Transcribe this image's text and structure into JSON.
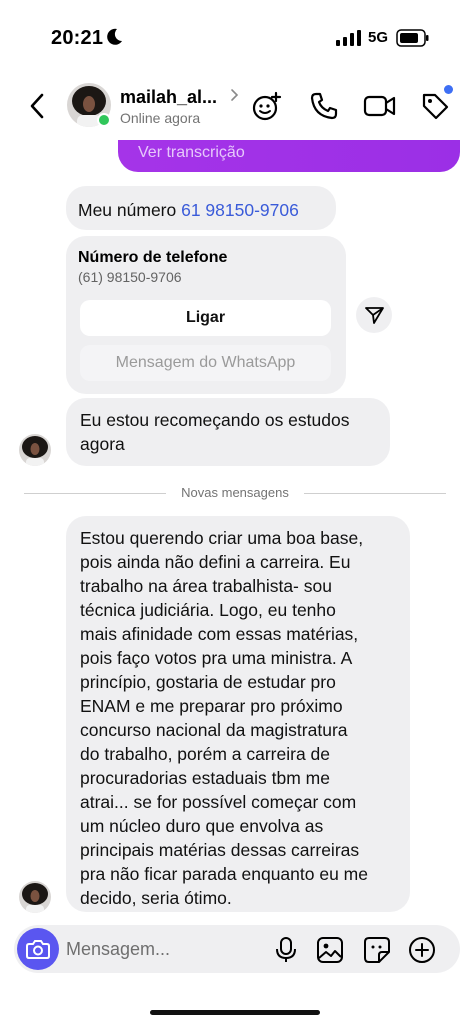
{
  "status_bar": {
    "time": "20:21",
    "network": "5G",
    "icons": [
      "moon-icon",
      "signal-icon",
      "battery-icon"
    ]
  },
  "header": {
    "contact_name": "mailah_al...",
    "contact_status": "Online agora",
    "icons": [
      "back-icon",
      "sticker-effects-icon",
      "phone-icon",
      "video-icon",
      "tag-icon"
    ],
    "online_color": "#30c65a",
    "notification_dot_color": "#3e6ff4"
  },
  "chat": {
    "transcription_label": "Ver transcrição",
    "phone_message": {
      "prefix": "Meu número ",
      "number": "61 98150-9706"
    },
    "phone_card": {
      "title": "Número de telefone",
      "number": "(61) 98150-9706",
      "call_button": "Ligar",
      "whatsapp_button": "Mensagem do WhatsApp"
    },
    "restart_message_lines": [
      "Eu estou recomeçando os estudos",
      "agora"
    ],
    "divider_label": "Novas mensagens",
    "long_message_lines": [
      "Estou querendo criar uma boa base,",
      "pois ainda não defini a carreira. Eu",
      "trabalho na área trabalhista- sou",
      "técnica judiciária. Logo, eu tenho",
      "mais afinidade com essas matérias,",
      "pois faço votos pra uma ministra. A",
      "princípio, gostaria de estudar pro",
      "ENAM e me preparar pro próximo",
      "concurso nacional da magistratura",
      "do trabalho, porém a carreira de",
      "procuradorias estaduais tbm me",
      "atrai... se for possível começar com",
      "um núcleo duro que envolva as",
      "principais matérias dessas carreiras",
      "pra não ficar parada enquanto eu me",
      "decido, seria ótimo."
    ],
    "bubble_color": "#efeff1",
    "link_color": "#3a5bd9",
    "sent_gradient": [
      "#a534e8",
      "#9b2fe6"
    ]
  },
  "composer": {
    "placeholder": "Mensagem...",
    "icons": [
      "camera-icon",
      "microphone-icon",
      "gallery-icon",
      "sticker-icon",
      "add-icon"
    ],
    "camera_color": "#5a56f0"
  }
}
